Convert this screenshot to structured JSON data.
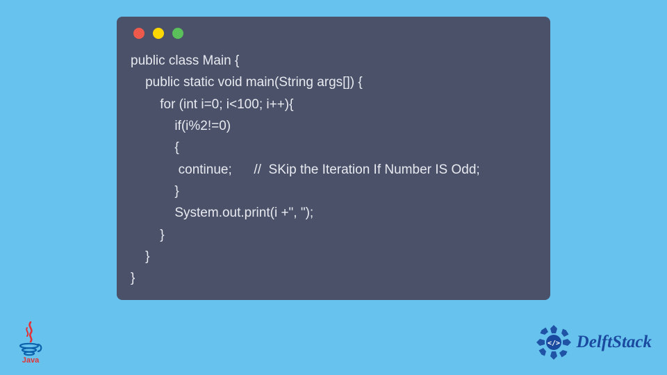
{
  "code": {
    "lines": [
      "public class Main {",
      "    public static void main(String args[]) {",
      "        for (int i=0; i<100; i++){",
      "            if(i%2!=0)",
      "            {",
      "             continue;      //  SKip the Iteration If Number IS Odd;",
      "            }",
      "            System.out.print(i +\", \");",
      "        }",
      "    }",
      "}"
    ]
  },
  "logos": {
    "java_label": "Java",
    "delft_label": "DelftStack"
  },
  "colors": {
    "page_bg": "#67c3ed",
    "window_bg": "#4a5169",
    "code_text": "#e8eaf0",
    "delft_blue": "#1a4aa0",
    "java_red": "#e23237",
    "java_blue": "#0d62ac"
  }
}
